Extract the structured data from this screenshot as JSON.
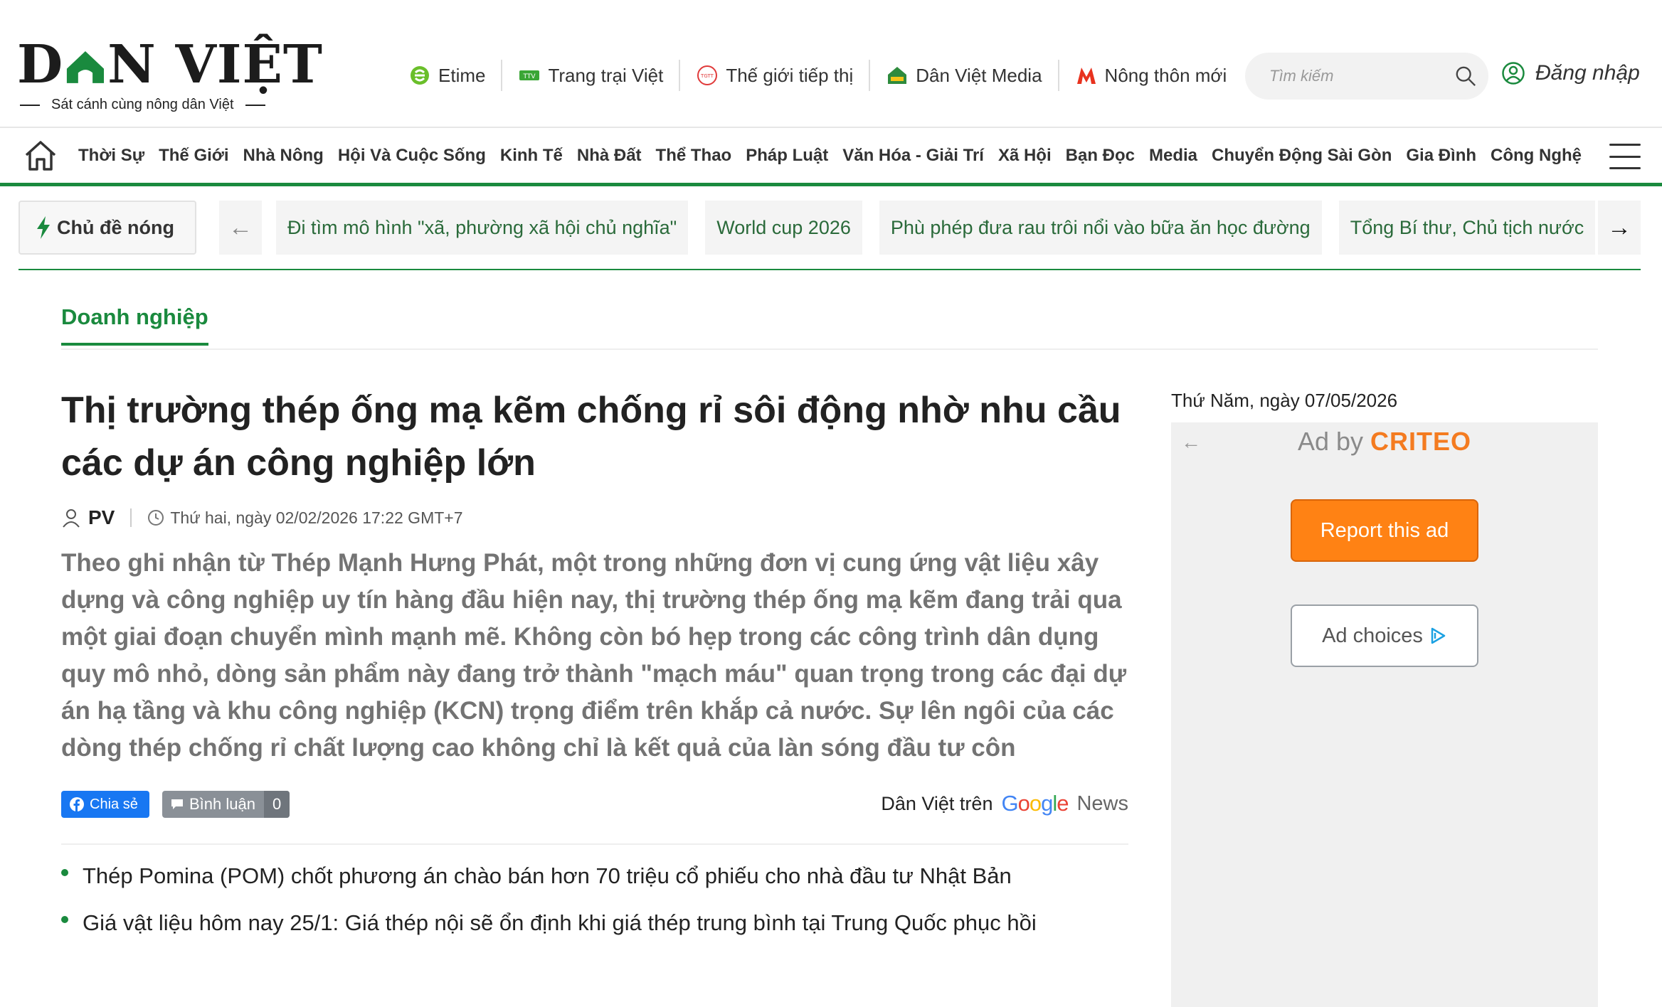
{
  "header": {
    "logo_prefix": "D",
    "logo_suffix": "N VIỆT",
    "tagline": "Sát cánh cùng nông dân Việt",
    "partners": [
      {
        "label": "Etime",
        "icon": "etime-icon"
      },
      {
        "label": "Trang trại Việt",
        "icon": "ttv-icon"
      },
      {
        "label": "Thế giới tiếp thị",
        "icon": "tgtt-icon"
      },
      {
        "label": "Dân Việt Media",
        "icon": "media-house-icon"
      },
      {
        "label": "Nông thôn mới",
        "icon": "ntm-icon"
      }
    ],
    "search_placeholder": "Tìm kiếm",
    "login_label": "Đăng nhập"
  },
  "nav": {
    "items": [
      "Thời Sự",
      "Thế Giới",
      "Nhà Nông",
      "Hội Và Cuộc Sống",
      "Kinh Tế",
      "Nhà Đất",
      "Thể Thao",
      "Pháp Luật",
      "Văn Hóa - Giải Trí",
      "Xã Hội",
      "Bạn Đọc",
      "Media",
      "Chuyển Động Sài Gòn",
      "Gia Đình",
      "Công Nghệ"
    ]
  },
  "hot_topics": {
    "label": "Chủ đề nóng",
    "prev": "←",
    "next": "→",
    "items": [
      "Đi tìm mô hình \"xã, phường xã hội chủ nghĩa\"",
      "World cup 2026",
      "Phù phép đưa rau trôi nổi vào bữa ăn học đường",
      "Tổng Bí thư, Chủ tịch nước"
    ]
  },
  "category": "Doanh nghiệp",
  "article": {
    "title": "Thị trường thép ống mạ kẽm chống rỉ sôi động nhờ nhu cầu các dự án công nghiệp lớn",
    "author": "PV",
    "published": "Thứ hai, ngày 02/02/2026 17:22 GMT+7",
    "sapo": "Theo ghi nhận từ Thép Mạnh Hưng Phát, một trong những đơn vị cung ứng vật liệu xây dựng và công nghiệp uy tín hàng đầu hiện nay, thị trường thép ống mạ kẽm đang trải qua một giai đoạn chuyển mình mạnh mẽ. Không còn bó hẹp trong các công trình dân dụng quy mô nhỏ, dòng sản phẩm này đang trở thành \"mạch máu\" quan trọng trong các đại dự án hạ tầng và khu công nghiệp (KCN) trọng điểm trên khắp cả nước. Sự lên ngôi của các dòng thép chống rỉ chất lượng cao không chỉ là kết quả của làn sóng đầu tư côn",
    "share_label": "Chia sẻ",
    "comment_label": "Bình luận",
    "comment_count": "0",
    "gnews_prefix": "Dân Việt trên",
    "gnews_news": "News",
    "related": [
      "Thép Pomina (POM) chốt phương án chào bán hơn 70 triệu cổ phiếu cho nhà đầu tư Nhật Bản",
      "Giá vật liệu hôm nay 25/1: Giá thép nội sẽ ổn định khi giá thép trung bình tại Trung Quốc phục hồi"
    ]
  },
  "sidebar": {
    "date": "Thứ Năm, ngày 07/05/2026",
    "ad": {
      "ad_by": "Ad by",
      "brand": "CRITEO",
      "report_label": "Report this ad",
      "choices_label": "Ad choices"
    }
  },
  "colors": {
    "brand_green": "#1a8a3e",
    "report_orange": "#ff8214",
    "facebook_blue": "#1877f2"
  }
}
